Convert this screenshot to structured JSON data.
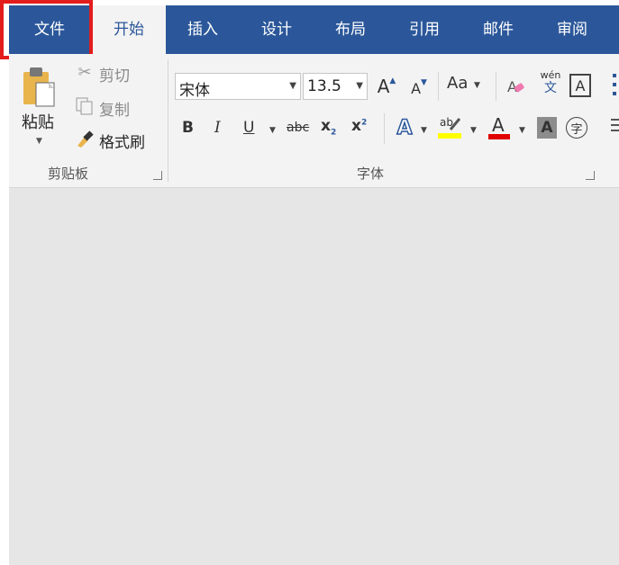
{
  "tabs": [
    "文件",
    "开始",
    "插入",
    "设计",
    "布局",
    "引用",
    "邮件",
    "审阅"
  ],
  "clipboard": {
    "paste_label": "粘贴",
    "cut_label": "剪切",
    "copy_label": "复制",
    "format_painter_label": "格式刷",
    "group_label": "剪贴板"
  },
  "font": {
    "font_name": "宋体",
    "font_size": "13.5",
    "change_case_label": "Aa",
    "phonetic_top": "wén",
    "phonetic_bottom": "文",
    "group_label": "字体",
    "bold": "B",
    "italic": "I",
    "underline": "U",
    "strike": "abc",
    "subscript": "x",
    "subscript_mark": "2",
    "superscript": "x",
    "superscript_mark": "2",
    "enclose_char": "字"
  },
  "colors": {
    "tab_bar": "#2b579a",
    "highlight_box": "#e31c1c",
    "text_highlight": "#ffff00",
    "font_color": "#e00000"
  }
}
